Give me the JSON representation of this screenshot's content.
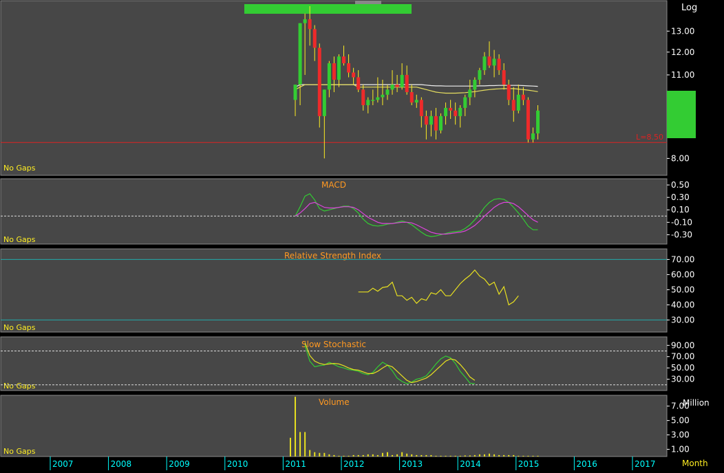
{
  "scale_label": "Log",
  "interval_label": "Month",
  "gap_label": "No Gaps",
  "colors": {
    "panel_bg": "#474747",
    "up": "#33cc33",
    "down": "#ee2a2a",
    "wick": "#ffee22",
    "ma_fast": "#e8e060",
    "ma_slow": "#f0f0f0",
    "macd": "#33cc33",
    "signal": "#dd44dd",
    "rsi": "#e8e020",
    "stoch_k": "#33cc33",
    "stoch_d": "#e8e020",
    "volume": "#e8e020",
    "title": "#ff9922",
    "axis_text": "#ffffff",
    "time_text": "#00ffff",
    "support": "#dd2222"
  },
  "chart_data": [
    {
      "type": "candlestick",
      "scale": "log",
      "ylim": [
        7.5,
        14.6
      ],
      "yticks": [
        "8.00",
        "11.00",
        "12.00",
        "13.00"
      ],
      "yticks_values": [
        8,
        11,
        12,
        13
      ],
      "support_level": 8.5,
      "support_label": "L=8.50",
      "x_unit": "month",
      "candles_start": "2011-03",
      "candles": [
        [
          10.0,
          10.6,
          9.4,
          10.6
        ],
        [
          10.6,
          13.4,
          9.8,
          13.4
        ],
        [
          13.4,
          13.9,
          11.0,
          13.6
        ],
        [
          13.6,
          14.3,
          12.3,
          13.1
        ],
        [
          13.1,
          13.3,
          11.6,
          12.2
        ],
        [
          12.2,
          12.4,
          9.0,
          9.4
        ],
        [
          9.4,
          10.4,
          8.0,
          10.4
        ],
        [
          10.4,
          11.6,
          10.1,
          11.5
        ],
        [
          11.5,
          11.8,
          10.3,
          10.8
        ],
        [
          10.8,
          11.9,
          10.5,
          11.8
        ],
        [
          11.8,
          12.3,
          11.4,
          11.5
        ],
        [
          11.5,
          11.9,
          10.9,
          11.1
        ],
        [
          11.1,
          11.3,
          10.6,
          10.9
        ],
        [
          10.9,
          11.2,
          10.3,
          10.4
        ],
        [
          10.4,
          10.6,
          9.6,
          9.8
        ],
        [
          9.8,
          10.1,
          9.5,
          10.0
        ],
        [
          10.0,
          10.4,
          9.8,
          10.0
        ],
        [
          10.0,
          10.9,
          9.9,
          10.1
        ],
        [
          10.1,
          10.8,
          9.8,
          10.2
        ],
        [
          10.2,
          10.6,
          10.0,
          10.4
        ],
        [
          10.4,
          11.2,
          10.2,
          10.6
        ],
        [
          10.6,
          11.0,
          10.3,
          10.5
        ],
        [
          10.5,
          11.5,
          10.4,
          11.0
        ],
        [
          11.0,
          11.4,
          10.2,
          10.3
        ],
        [
          10.3,
          10.6,
          9.8,
          9.9
        ],
        [
          9.9,
          10.2,
          9.7,
          10.0
        ],
        [
          10.0,
          10.1,
          9.0,
          9.4
        ],
        [
          9.4,
          9.6,
          8.6,
          9.1
        ],
        [
          9.1,
          9.6,
          8.7,
          9.4
        ],
        [
          9.4,
          9.7,
          8.6,
          8.9
        ],
        [
          8.9,
          9.5,
          8.8,
          9.4
        ],
        [
          9.4,
          9.9,
          9.1,
          9.7
        ],
        [
          9.7,
          10.0,
          9.3,
          9.6
        ],
        [
          9.6,
          9.9,
          9.1,
          9.4
        ],
        [
          9.4,
          9.8,
          9.0,
          9.7
        ],
        [
          9.7,
          10.2,
          9.4,
          10.1
        ],
        [
          10.1,
          10.8,
          9.8,
          10.4
        ],
        [
          10.4,
          10.9,
          10.1,
          10.8
        ],
        [
          10.8,
          11.3,
          10.6,
          11.2
        ],
        [
          11.2,
          12.0,
          11.0,
          11.8
        ],
        [
          11.8,
          12.5,
          11.3,
          11.4
        ],
        [
          11.4,
          12.1,
          10.9,
          11.7
        ],
        [
          11.7,
          11.9,
          11.0,
          11.2
        ],
        [
          11.2,
          11.5,
          10.4,
          10.6
        ],
        [
          10.6,
          10.8,
          9.8,
          10.0
        ],
        [
          10.0,
          10.5,
          9.2,
          9.6
        ],
        [
          9.6,
          10.6,
          9.5,
          10.2
        ],
        [
          10.2,
          10.5,
          9.8,
          10.0
        ],
        [
          10.0,
          10.1,
          8.5,
          8.6
        ],
        [
          8.6,
          9.0,
          8.5,
          8.8
        ],
        [
          8.8,
          9.8,
          8.6,
          9.6
        ]
      ],
      "ma_fast": [
        10.4,
        10.5,
        10.6,
        10.6,
        10.6,
        10.6,
        10.6,
        10.6,
        10.6,
        10.6,
        10.6,
        10.6,
        10.6,
        10.5,
        10.5,
        10.5,
        10.5,
        10.5,
        10.5,
        10.5,
        10.5,
        10.5,
        10.5,
        10.5,
        10.5,
        10.5,
        10.45,
        10.4,
        10.35,
        10.3,
        10.28,
        10.26,
        10.26,
        10.26,
        10.27,
        10.28,
        10.3,
        10.32,
        10.35,
        10.38,
        10.4,
        10.42,
        10.43,
        10.44,
        10.44,
        10.44,
        10.42,
        10.4,
        10.38,
        10.35,
        10.32
      ],
      "ma_slow": [
        10.5,
        10.6,
        10.6,
        10.6,
        10.6,
        10.6,
        10.6,
        10.6,
        10.6,
        10.6,
        10.6,
        10.6,
        10.6,
        10.6,
        10.6,
        10.6,
        10.6,
        10.6,
        10.6,
        10.6,
        10.6,
        10.6,
        10.6,
        10.6,
        10.6,
        10.6,
        10.6,
        10.58,
        10.56,
        10.55,
        10.55,
        10.54,
        10.54,
        10.54,
        10.54,
        10.54,
        10.54,
        10.54,
        10.55,
        10.55,
        10.56,
        10.56,
        10.57,
        10.57,
        10.57,
        10.57,
        10.57,
        10.56,
        10.55,
        10.54,
        10.53
      ]
    },
    {
      "type": "line",
      "title": "MACD",
      "ylim": [
        -0.45,
        0.6
      ],
      "yticks": [
        "0.50",
        "0.30",
        "0.10",
        "-0.10",
        "-0.30"
      ],
      "yticks_values": [
        0.5,
        0.3,
        0.1,
        -0.1,
        -0.3
      ],
      "zero_line": 0.0,
      "x_start": "2011-03",
      "series": [
        {
          "key": "macd",
          "values": [
            0.0,
            0.15,
            0.32,
            0.36,
            0.26,
            0.12,
            0.08,
            0.1,
            0.12,
            0.14,
            0.16,
            0.16,
            0.12,
            0.05,
            -0.05,
            -0.12,
            -0.15,
            -0.16,
            -0.15,
            -0.13,
            -0.12,
            -0.1,
            -0.08,
            -0.1,
            -0.14,
            -0.2,
            -0.26,
            -0.31,
            -0.33,
            -0.32,
            -0.3,
            -0.28,
            -0.26,
            -0.25,
            -0.24,
            -0.2,
            -0.14,
            -0.06,
            0.03,
            0.14,
            0.22,
            0.27,
            0.28,
            0.27,
            0.22,
            0.14,
            0.05,
            -0.05,
            -0.16,
            -0.22,
            -0.22
          ]
        },
        {
          "key": "signal",
          "values": [
            0.0,
            0.05,
            0.12,
            0.2,
            0.22,
            0.18,
            0.14,
            0.13,
            0.13,
            0.14,
            0.15,
            0.15,
            0.14,
            0.1,
            0.04,
            -0.02,
            -0.06,
            -0.1,
            -0.12,
            -0.12,
            -0.12,
            -0.11,
            -0.1,
            -0.1,
            -0.11,
            -0.14,
            -0.18,
            -0.22,
            -0.26,
            -0.28,
            -0.29,
            -0.29,
            -0.28,
            -0.27,
            -0.26,
            -0.24,
            -0.2,
            -0.15,
            -0.08,
            0.0,
            0.07,
            0.14,
            0.19,
            0.22,
            0.22,
            0.2,
            0.15,
            0.08,
            0.01,
            -0.06,
            -0.1
          ]
        }
      ]
    },
    {
      "type": "line",
      "title": "Relative Strength Index",
      "ylim": [
        22,
        77
      ],
      "yticks": [
        "70.00",
        "60.00",
        "50.00",
        "40.00",
        "30.00"
      ],
      "yticks_values": [
        70,
        60,
        50,
        40,
        30
      ],
      "guides": [
        70,
        30
      ],
      "x_start": "2012-04",
      "series": [
        {
          "key": "rsi",
          "values": [
            48.5,
            48.5,
            48.5,
            51,
            49,
            51.5,
            52,
            55,
            46,
            46,
            43,
            45,
            41,
            44,
            43,
            48,
            47,
            50,
            46,
            46,
            50,
            54,
            57,
            59.5,
            63,
            59,
            57,
            53,
            55,
            47,
            52,
            40,
            42,
            46
          ]
        }
      ]
    },
    {
      "type": "line",
      "title": "Slow Stochastic",
      "ylim": [
        10,
        105
      ],
      "yticks": [
        "90.00",
        "70.00",
        "50.00",
        "30.00"
      ],
      "yticks_values": [
        90,
        70,
        50,
        30
      ],
      "guides": [
        80,
        20
      ],
      "x_start": "2011-05",
      "series": [
        {
          "key": "stoch_k",
          "values": [
            90,
            62,
            52,
            54,
            55,
            60,
            56,
            52,
            50,
            47,
            46,
            44,
            40,
            38,
            42,
            52,
            60,
            55,
            45,
            32,
            26,
            22,
            25,
            30,
            32,
            36,
            46,
            57,
            66,
            71,
            68,
            58,
            44,
            34,
            23,
            22
          ]
        },
        {
          "key": "stoch_d",
          "values": [
            95,
            72,
            62,
            58,
            56,
            57,
            58,
            57,
            54,
            50,
            47,
            46,
            43,
            40,
            40,
            44,
            50,
            55,
            52,
            44,
            36,
            28,
            24,
            26,
            29,
            32,
            38,
            46,
            54,
            62,
            66,
            64,
            56,
            46,
            34,
            28
          ]
        }
      ]
    },
    {
      "type": "bar",
      "title": "Volume",
      "ylabel": "Million",
      "ylim": [
        0,
        8.5
      ],
      "yticks": [
        "7.00",
        "5.00",
        "3.00",
        "1.00"
      ],
      "yticks_values": [
        7,
        5,
        3,
        1
      ],
      "x_start": "2011-02",
      "values": [
        2.6,
        8.3,
        3.4,
        3.4,
        0.9,
        0.6,
        0.5,
        0.5,
        0.3,
        0.2,
        0.1,
        0.1,
        0.1,
        0.2,
        0.2,
        0.2,
        0.3,
        0.3,
        0.2,
        0.5,
        0.6,
        0.2,
        0.3,
        0.6,
        0.4,
        0.3,
        0.2,
        0.2,
        0.2,
        0.2,
        0.1,
        0.1,
        0.1,
        0.1,
        0.1,
        0.1,
        0.15,
        0.15,
        0.2,
        0.3,
        0.3,
        0.4,
        0.3,
        0.2,
        0.2,
        0.2,
        0.2,
        0.1,
        0.1,
        0.1,
        0.1,
        0.1
      ]
    }
  ],
  "time_axis": {
    "labels": [
      "2007",
      "2008",
      "2009",
      "2010",
      "2011",
      "2012",
      "2013",
      "2014",
      "2015",
      "2016",
      "2017"
    ]
  }
}
